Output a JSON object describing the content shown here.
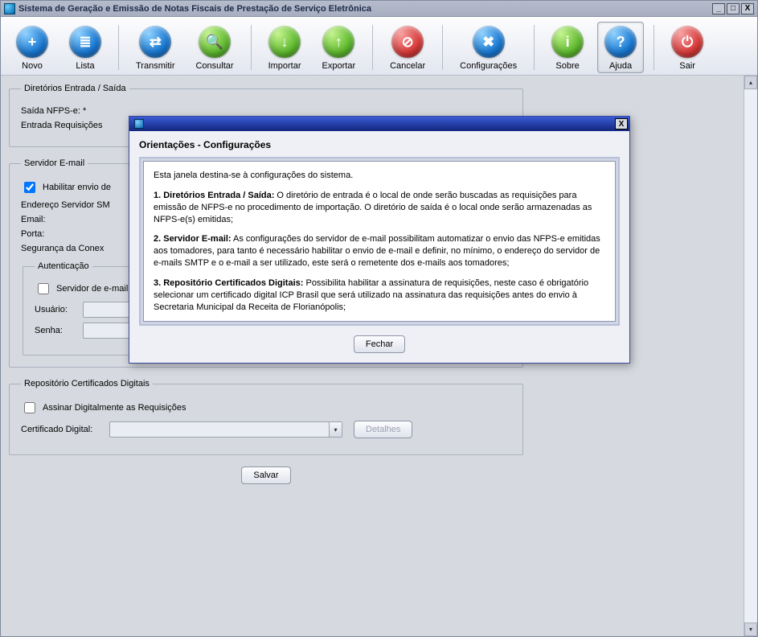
{
  "window": {
    "title": "Sistema de Geração e Emissão de Notas Fiscais de Prestação de Serviço Eletrônica"
  },
  "toolbar": {
    "novo": "Novo",
    "lista": "Lista",
    "transmitir": "Transmitir",
    "consultar": "Consultar",
    "importar": "Importar",
    "exportar": "Exportar",
    "cancelar": "Cancelar",
    "configuracoes": "Configurações",
    "sobre": "Sobre",
    "ajuda": "Ajuda",
    "sair": "Sair"
  },
  "dir_group": {
    "legend": "Diretórios Entrada / Saída",
    "saida_label": "Saída NFPS-e: *",
    "entrada_label": "Entrada Requisições"
  },
  "email_group": {
    "legend": "Servidor E-mail",
    "habilitar": "Habilitar envio de",
    "endereco": "Endereço Servidor SM",
    "email": "Email:",
    "porta": "Porta:",
    "seguranca": "Segurança da Conex",
    "auth_legend": "Autenticação",
    "auth_check": "Servidor de e-mail com autenticação",
    "usuario": "Usuário:",
    "senha": "Senha:"
  },
  "cert_group": {
    "legend": "Repositório Certificados Digitais",
    "assinar": "Assinar Digitalmente as Requisições",
    "cert_label": "Certificado Digital:",
    "detalhes": "Detalhes"
  },
  "salvar": "Salvar",
  "modal": {
    "heading": "Orientações - Configurações",
    "intro": "Esta janela destina-se à configurações do sistema.",
    "s1_title": "1. Diretórios Entrada / Saída:",
    "s1_text": " O diretório de entrada é o local de onde serão buscadas as requisições para emissão de NFPS-e no procedimento de importação. O diretório de saída é o local onde serão armazenadas as NFPS-e(s) emitidas;",
    "s2_title": "2. Servidor E-mail:",
    "s2_text": " As configurações do servidor de e-mail possibilitam automatizar o envio das NFPS-e emitidas aos tomadores, para tanto é necessário habilitar o envio de e-mail e definir, no mínimo, o endereço do servidor de e-mails SMTP e o e-mail a ser utilizado, este será o remetente dos e-mails aos tomadores;",
    "s3_title": "3. Repositório Certificados Digitais:",
    "s3_text": " Possibilita habilitar a assinatura de requisições, neste caso é obrigatório selecionar um certificado digital ICP Brasil que será utilizado na assinatura das requisições antes do envio à Secretaria Municipal da Receita de Florianópolis;",
    "close": "Fechar"
  },
  "glyphs": {
    "plus": "+",
    "list": "≣",
    "arrows": "⇄",
    "search": "🔍",
    "down": "↓",
    "up": "↑",
    "nope": "⊘",
    "tools": "✖",
    "info": "i",
    "help": "?",
    "power": "⏻",
    "tri_down": "▾",
    "tri_up": "▴"
  }
}
